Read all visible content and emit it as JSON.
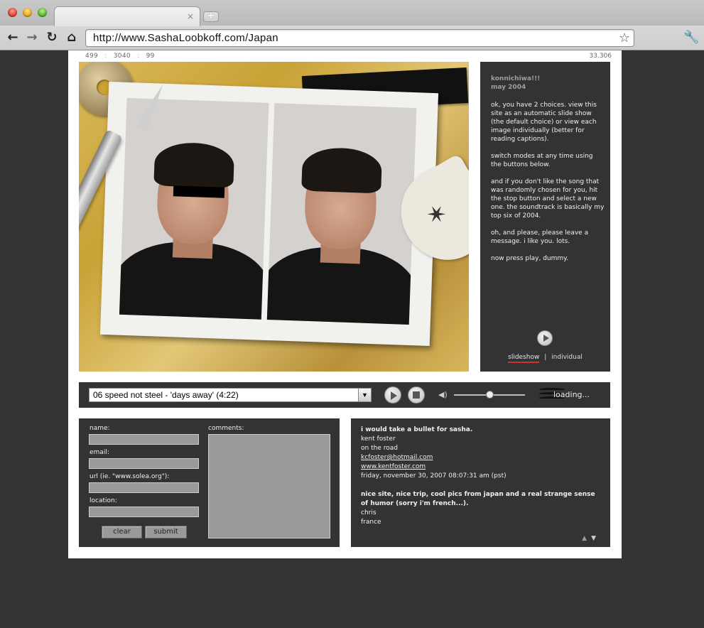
{
  "browser": {
    "url": "http://www.SashaLoobkoff.com/Japan",
    "tab_close": "×",
    "new_tab": "+",
    "back": "←",
    "forward": "→",
    "reload": "↻",
    "home": "⌂",
    "star": "☆",
    "wrench": "🔧"
  },
  "stats": {
    "left": [
      "499",
      "3040",
      "99"
    ],
    "separator": ":",
    "right": "33.306"
  },
  "sidebar": {
    "heading_line1": "konnichiwa!!!",
    "heading_line2": "may 2004",
    "paragraphs": [
      "ok, you have 2 choices. view this site as an automatic slide show (the default choice) or view each image individually (better for reading captions).",
      "switch modes at any time using the buttons below.",
      "and if you don't like the song that was randomly chosen for you, hit the stop button and select a new one. the soundtrack is basically my top six of 2004.",
      "oh, and please, please leave a message.  i like you. lots.",
      "now press play, dummy."
    ],
    "mode_slideshow": "slideshow",
    "mode_separator": "|",
    "mode_individual": "individual"
  },
  "player": {
    "song": "06 speed not steel - 'days away' (4:22)",
    "select_arrow": "▼",
    "volume_icon": "◀)",
    "volume": 0.5,
    "status": "loading..."
  },
  "form": {
    "name_label": "name:",
    "email_label": "email:",
    "url_label": "url (ie. \"www.solea.org\"):",
    "location_label": "location:",
    "comments_label": "comments:",
    "clear_label": "clear",
    "submit_label": "submit"
  },
  "messages": [
    {
      "title": "i would take a bullet for sasha.",
      "name": "kent foster",
      "location": "on the road",
      "email": "kcfoster@hotmail.com",
      "website": "www.kentfoster.com",
      "date": "friday, november 30, 2007 08:07:31 am (pst)"
    },
    {
      "title_line1": "nice site, nice trip, cool pics from japan and a real strange sense",
      "title_line2": "of humor (sorry i'm french...).",
      "name": "chris",
      "location": "france"
    }
  ],
  "pager": {
    "up": "▲",
    "down": "▼"
  }
}
